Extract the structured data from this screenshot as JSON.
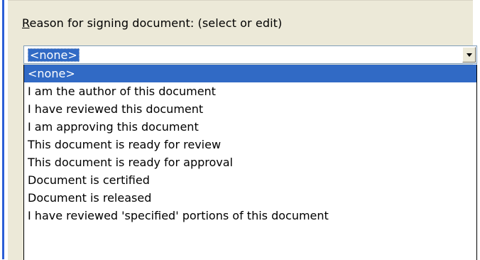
{
  "reason": {
    "label_accel": "R",
    "label_rest": "eason for signing document: (select or edit)",
    "combo_value": "<none>",
    "options": [
      "<none>",
      "I am the author of this document",
      "I have reviewed this document",
      "I am approving this document",
      "This document is ready for review",
      "This document is ready for approval",
      "Document is certified",
      "Document is released",
      "I have reviewed 'specified' portions of this document"
    ],
    "selected_index": 0
  },
  "colors": {
    "selection_bg": "#316ac5",
    "panel_bg": "#ece9d8",
    "accent_stripe": "#2c5fd6"
  },
  "icons": {
    "dropdown_arrow": "chevron-down-icon"
  }
}
